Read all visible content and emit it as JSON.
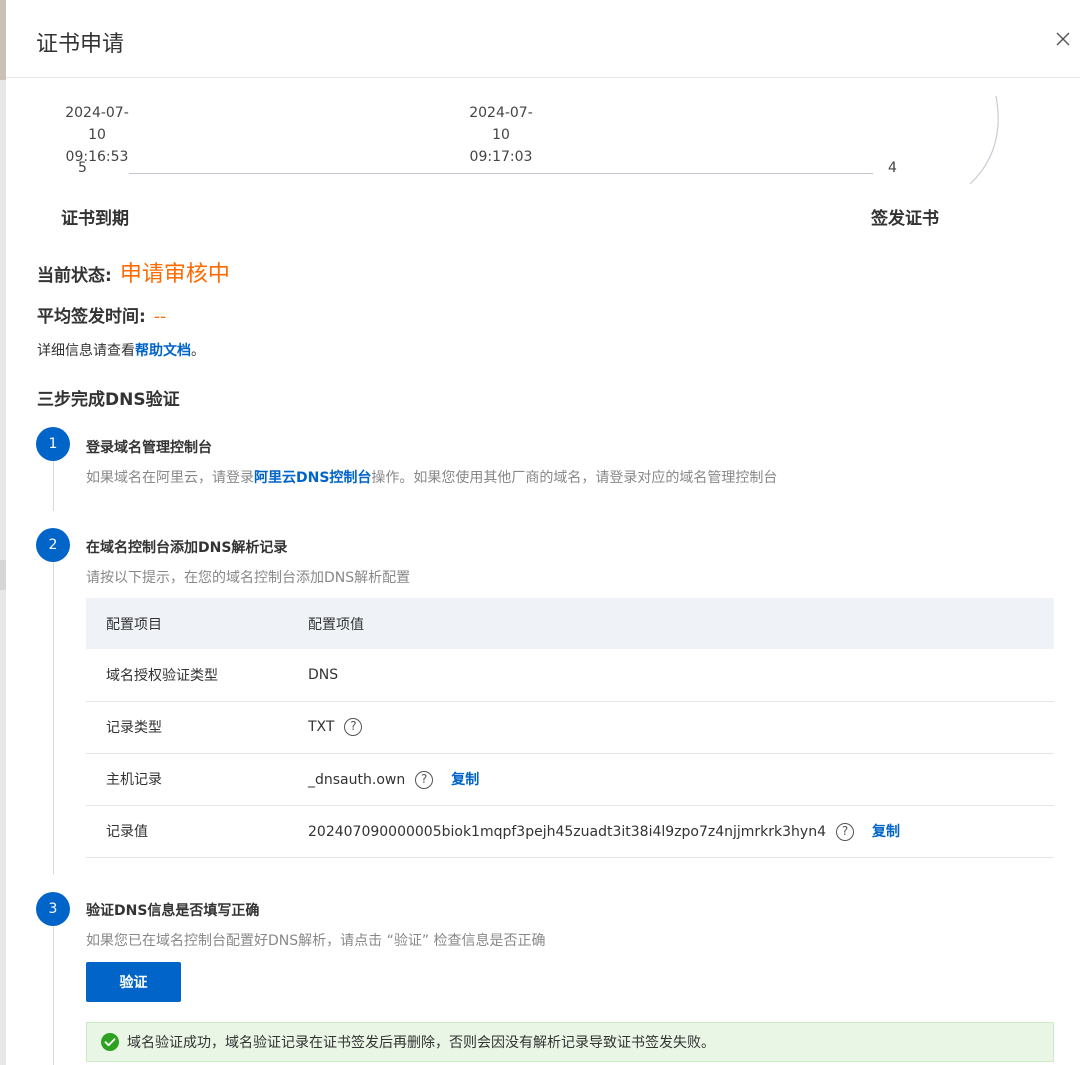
{
  "dialog": {
    "title": "证书申请"
  },
  "timeline": {
    "start": {
      "date": "2024-07-10",
      "time": "09:16:53",
      "count": "5",
      "label": "证书到期"
    },
    "mid": {
      "date": "2024-07-10",
      "time": "09:17:03"
    },
    "end": {
      "count": "4",
      "label": "签发证书"
    }
  },
  "status": {
    "label": "当前状态:",
    "value": "申请审核中",
    "avg_label": "平均签发时间:",
    "avg_value": "--",
    "help_prefix": "详细信息请查看",
    "help_link": "帮助文档",
    "help_suffix": "。"
  },
  "dns_guide": {
    "title": "三步完成DNS验证",
    "steps": [
      {
        "number": "1",
        "title": "登录域名管理控制台",
        "desc_prefix": "如果域名在阿里云，请登录",
        "desc_link": "阿里云DNS控制台",
        "desc_suffix": "操作。如果您使用其他厂商的域名，请登录对应的域名管理控制台"
      },
      {
        "number": "2",
        "title": "在域名控制台添加DNS解析记录",
        "desc": "请按以下提示，在您的域名控制台添加DNS解析配置"
      },
      {
        "number": "3",
        "title": "验证DNS信息是否填写正确",
        "desc": "如果您已在域名控制台配置好DNS解析，请点击 “验证” 检查信息是否正确"
      }
    ]
  },
  "config_table": {
    "headers": [
      "配置项目",
      "配置项值"
    ],
    "rows": [
      {
        "item": "域名授权验证类型",
        "value": "DNS"
      },
      {
        "item": "记录类型",
        "value": "TXT"
      },
      {
        "item": "主机记录",
        "value": "_dnsauth.own",
        "copy": "复制"
      },
      {
        "item": "记录值",
        "value": "202407090000005biok1mqpf3pejh45zuadt3it38i4l9zpo7z4njjmrkrk3hyn4",
        "copy": "复制"
      }
    ]
  },
  "verify": {
    "button": "验证",
    "success_message": "域名验证成功，域名验证记录在证书签发后再删除，否则会因没有解析记录导致证书签发失败。"
  },
  "colors": {
    "primary": "#0064c8",
    "warning": "#ff6a00",
    "success": "#2ea121",
    "success_bg": "#e9f6e6"
  }
}
